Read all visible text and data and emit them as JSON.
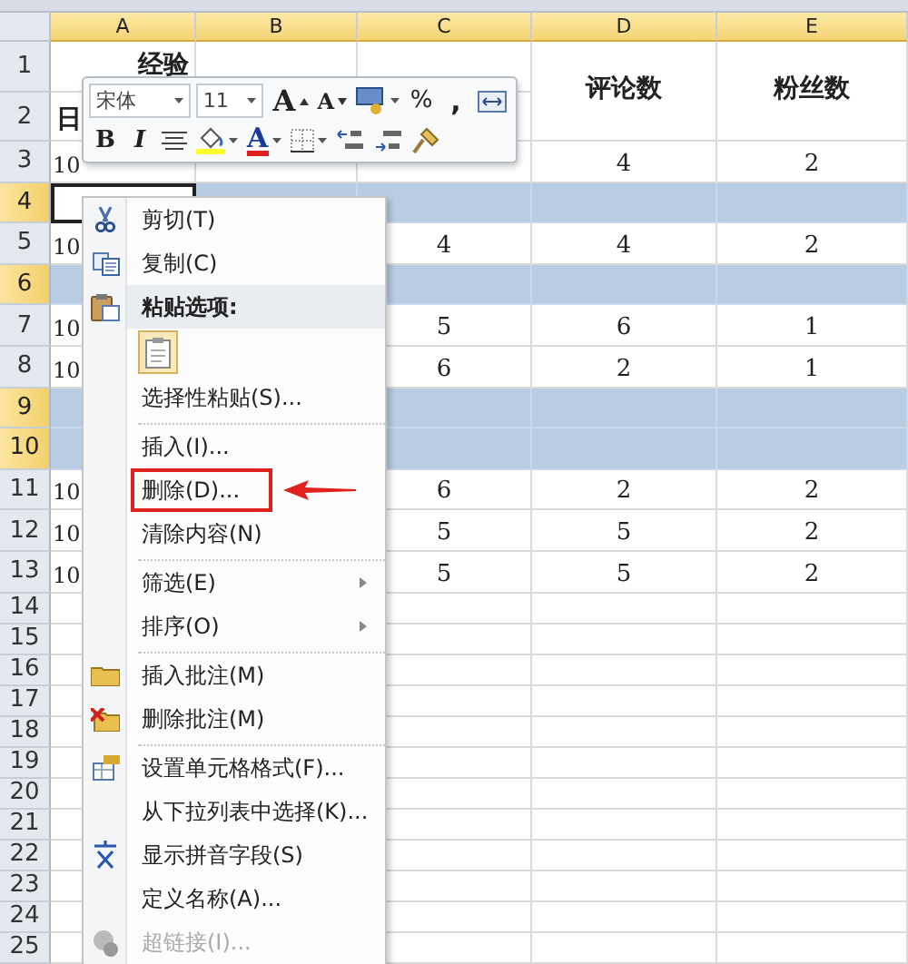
{
  "sheet": {
    "columns": [
      {
        "label": "A",
        "selected": true
      },
      {
        "label": "B",
        "selected": true
      },
      {
        "label": "C",
        "selected": true
      },
      {
        "label": "D",
        "selected": true
      },
      {
        "label": "E",
        "selected": true
      }
    ],
    "rows": [
      {
        "header": "1",
        "selected": false,
        "active": false,
        "cells": [
          "经验",
          "",
          "",
          "评论数",
          "粉丝数"
        ]
      },
      {
        "header": "2",
        "selected": false,
        "active": false,
        "cells": [
          "日",
          "",
          "",
          "",
          ""
        ]
      },
      {
        "header": "3",
        "selected": false,
        "active": false,
        "cells": [
          "10",
          "",
          "",
          "4",
          "2"
        ]
      },
      {
        "header": "4",
        "selected": true,
        "active": true,
        "cells": [
          "",
          "",
          "",
          "",
          ""
        ]
      },
      {
        "header": "5",
        "selected": false,
        "active": false,
        "cells": [
          "10",
          "",
          "4",
          "4",
          "2"
        ]
      },
      {
        "header": "6",
        "selected": true,
        "active": false,
        "cells": [
          "",
          "",
          "",
          "",
          ""
        ]
      },
      {
        "header": "7",
        "selected": false,
        "active": false,
        "cells": [
          "10",
          "",
          "5",
          "6",
          "1"
        ]
      },
      {
        "header": "8",
        "selected": false,
        "active": false,
        "cells": [
          "10",
          "",
          "6",
          "2",
          "1"
        ]
      },
      {
        "header": "9",
        "selected": true,
        "active": false,
        "cells": [
          "",
          "",
          "",
          "",
          ""
        ]
      },
      {
        "header": "10",
        "selected": true,
        "active": false,
        "cells": [
          "",
          "",
          "",
          "",
          ""
        ]
      },
      {
        "header": "11",
        "selected": false,
        "active": false,
        "cells": [
          "10",
          "",
          "6",
          "2",
          "2"
        ]
      },
      {
        "header": "12",
        "selected": false,
        "active": false,
        "cells": [
          "10",
          "",
          "5",
          "5",
          "2"
        ]
      },
      {
        "header": "13",
        "selected": false,
        "active": false,
        "cells": [
          "10",
          "",
          "5",
          "5",
          "2"
        ]
      },
      {
        "header": "14",
        "selected": false,
        "active": false,
        "cells": [
          "",
          "",
          "",
          "",
          ""
        ]
      },
      {
        "header": "15",
        "selected": false,
        "active": false,
        "cells": [
          "",
          "",
          "",
          "",
          ""
        ]
      },
      {
        "header": "16",
        "selected": false,
        "active": false,
        "cells": [
          "",
          "",
          "",
          "",
          ""
        ]
      },
      {
        "header": "17",
        "selected": false,
        "active": false,
        "cells": [
          "",
          "",
          "",
          "",
          ""
        ]
      },
      {
        "header": "18",
        "selected": false,
        "active": false,
        "cells": [
          "",
          "",
          "",
          "",
          ""
        ]
      },
      {
        "header": "19",
        "selected": false,
        "active": false,
        "cells": [
          "",
          "",
          "",
          "",
          ""
        ]
      },
      {
        "header": "20",
        "selected": false,
        "active": false,
        "cells": [
          "",
          "",
          "",
          "",
          ""
        ]
      },
      {
        "header": "21",
        "selected": false,
        "active": false,
        "cells": [
          "",
          "",
          "",
          "",
          ""
        ]
      },
      {
        "header": "22",
        "selected": false,
        "active": false,
        "cells": [
          "",
          "",
          "",
          "",
          ""
        ]
      },
      {
        "header": "23",
        "selected": false,
        "active": false,
        "cells": [
          "",
          "",
          "",
          "",
          ""
        ]
      },
      {
        "header": "24",
        "selected": false,
        "active": false,
        "cells": [
          "",
          "",
          "",
          "",
          ""
        ]
      },
      {
        "header": "25",
        "selected": false,
        "active": false,
        "cells": [
          "",
          "",
          "",
          "",
          ""
        ]
      }
    ]
  },
  "mini_toolbar": {
    "rows": [
      [
        {
          "kind": "font-field",
          "value": "宋体"
        },
        {
          "kind": "size-field",
          "value": "11"
        },
        {
          "kind": "grow-font",
          "label": "A"
        },
        {
          "kind": "shrink-font",
          "label": "A"
        },
        {
          "kind": "accounting"
        },
        {
          "kind": "percent",
          "label": "%"
        },
        {
          "kind": "comma",
          "label": ","
        },
        {
          "kind": "merge"
        }
      ],
      [
        {
          "kind": "bold",
          "label": "B"
        },
        {
          "kind": "italic",
          "label": "I"
        },
        {
          "kind": "center"
        },
        {
          "kind": "fill-color"
        },
        {
          "kind": "font-color",
          "label": "A"
        },
        {
          "kind": "borders"
        },
        {
          "kind": "increase-decimal"
        },
        {
          "kind": "decrease-decimal"
        },
        {
          "kind": "format-painter"
        }
      ]
    ]
  },
  "context_menu": {
    "items": [
      {
        "kind": "item",
        "label": "剪切(T)",
        "disabled": false,
        "submenu": false,
        "annotated": false
      },
      {
        "kind": "item",
        "label": "复制(C)",
        "disabled": false,
        "submenu": false,
        "annotated": false
      },
      {
        "kind": "header",
        "label": "粘贴选项:"
      },
      {
        "kind": "paste-option"
      },
      {
        "kind": "item",
        "label": "选择性粘贴(S)...",
        "disabled": false,
        "submenu": false,
        "annotated": false
      },
      {
        "kind": "separator"
      },
      {
        "kind": "item",
        "label": "插入(I)...",
        "disabled": false,
        "submenu": false,
        "annotated": false
      },
      {
        "kind": "item",
        "label": "删除(D)...",
        "disabled": false,
        "submenu": false,
        "annotated": true
      },
      {
        "kind": "item",
        "label": "清除内容(N)",
        "disabled": false,
        "submenu": false,
        "annotated": false
      },
      {
        "kind": "separator"
      },
      {
        "kind": "item",
        "label": "筛选(E)",
        "disabled": false,
        "submenu": true,
        "annotated": false
      },
      {
        "kind": "item",
        "label": "排序(O)",
        "disabled": false,
        "submenu": true,
        "annotated": false
      },
      {
        "kind": "separator"
      },
      {
        "kind": "item",
        "label": "插入批注(M)",
        "disabled": false,
        "submenu": false,
        "annotated": false
      },
      {
        "kind": "item",
        "label": "删除批注(M)",
        "disabled": false,
        "submenu": false,
        "annotated": false
      },
      {
        "kind": "separator"
      },
      {
        "kind": "item",
        "label": "设置单元格格式(F)...",
        "disabled": false,
        "submenu": false,
        "annotated": false
      },
      {
        "kind": "item",
        "label": "从下拉列表中选择(K)...",
        "disabled": false,
        "submenu": false,
        "annotated": false
      },
      {
        "kind": "item",
        "label": "显示拼音字段(S)",
        "disabled": false,
        "submenu": false,
        "annotated": false
      },
      {
        "kind": "item",
        "label": "定义名称(A)...",
        "disabled": false,
        "submenu": false,
        "annotated": false
      },
      {
        "kind": "item",
        "label": "超链接(I)...",
        "disabled": true,
        "submenu": false,
        "annotated": false
      }
    ]
  }
}
